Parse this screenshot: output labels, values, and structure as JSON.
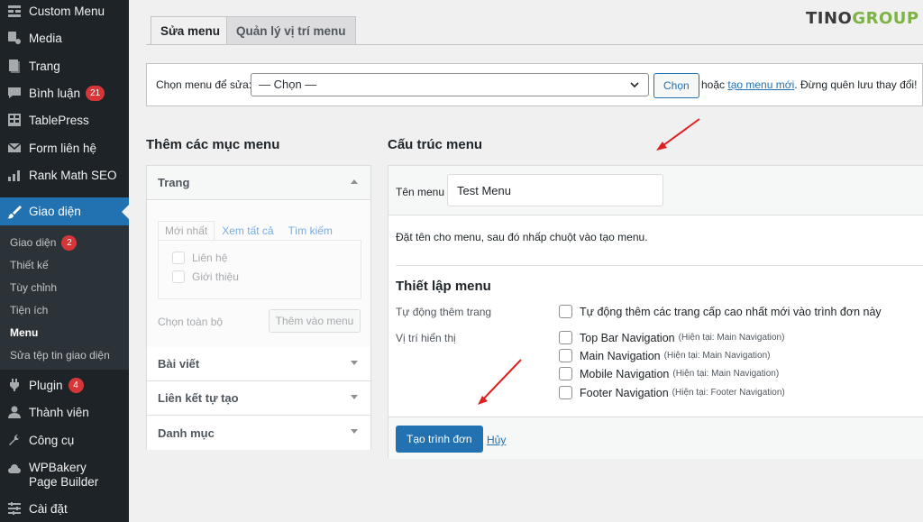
{
  "sidebar": {
    "items": [
      {
        "label": "Custom Menu",
        "icon": "grid-icon"
      },
      {
        "label": "Media",
        "icon": "media-icon"
      },
      {
        "label": "Trang",
        "icon": "page-icon"
      },
      {
        "label": "Bình luận",
        "icon": "comment-icon",
        "badge": "21"
      },
      {
        "label": "TablePress",
        "icon": "table-icon"
      },
      {
        "label": "Form liên hệ",
        "icon": "mail-icon"
      },
      {
        "label": "Rank Math SEO",
        "icon": "chart-icon"
      },
      {
        "label": "Giao diện",
        "icon": "brush-icon"
      },
      {
        "label": "Plugin",
        "icon": "plugin-icon",
        "badge": "4"
      },
      {
        "label": "Thành viên",
        "icon": "user-icon"
      },
      {
        "label": "Công cụ",
        "icon": "wrench-icon"
      },
      {
        "label": "WPBakery Page Builder",
        "icon": "cloud-icon"
      },
      {
        "label": "Cài đặt",
        "icon": "settings-icon"
      }
    ],
    "submenu": [
      {
        "label": "Giao diện",
        "badge": "2"
      },
      {
        "label": "Thiết kế"
      },
      {
        "label": "Tùy chỉnh"
      },
      {
        "label": "Tiện ích"
      },
      {
        "label": "Menu"
      },
      {
        "label": "Sửa tệp tin giao diện"
      }
    ]
  },
  "tabs": {
    "edit": "Sửa menu",
    "manage": "Quản lý vị trí menu"
  },
  "logo": {
    "part1": "TINO",
    "part2": "GROUP"
  },
  "select_bar": {
    "label": "Chọn menu để sửa:",
    "selected": "— Chọn —",
    "button": "Chọn",
    "after_text": "hoặc",
    "link": "tạo menu mới",
    "after_link": ". Đừng quên lưu thay đổi!"
  },
  "add_items": {
    "title": "Thêm các mục menu",
    "sections": [
      "Trang",
      "Bài viết",
      "Liên kết tự tạo",
      "Danh mục"
    ],
    "inner_tabs": [
      "Mới nhất",
      "Xem tất cả",
      "Tìm kiếm"
    ],
    "pages": [
      "Liên hệ",
      "Giới thiệu"
    ],
    "select_all": "Chọn toàn bộ",
    "add_button": "Thêm vào menu"
  },
  "structure": {
    "title": "Cấu trúc menu",
    "name_label": "Tên menu",
    "name_value": "Test Menu",
    "hint": "Đặt tên cho menu, sau đó nhấp chuột vào tạo menu.",
    "settings_title": "Thiết lập menu",
    "auto_add_label": "Tự động thêm trang",
    "auto_add_option": "Tự động thêm các trang cấp cao nhất mới vào trình đơn này",
    "location_label": "Vị trí hiển thị",
    "locations": [
      {
        "name": "Top Bar Navigation",
        "current": "(Hiện tại: Main Navigation)"
      },
      {
        "name": "Main Navigation",
        "current": "(Hiện tại: Main Navigation)"
      },
      {
        "name": "Mobile Navigation",
        "current": "(Hiện tại: Main Navigation)"
      },
      {
        "name": "Footer Navigation",
        "current": "(Hiện tại: Footer Navigation)"
      }
    ],
    "create_button": "Tạo trình đơn",
    "cancel": "Hủy"
  }
}
